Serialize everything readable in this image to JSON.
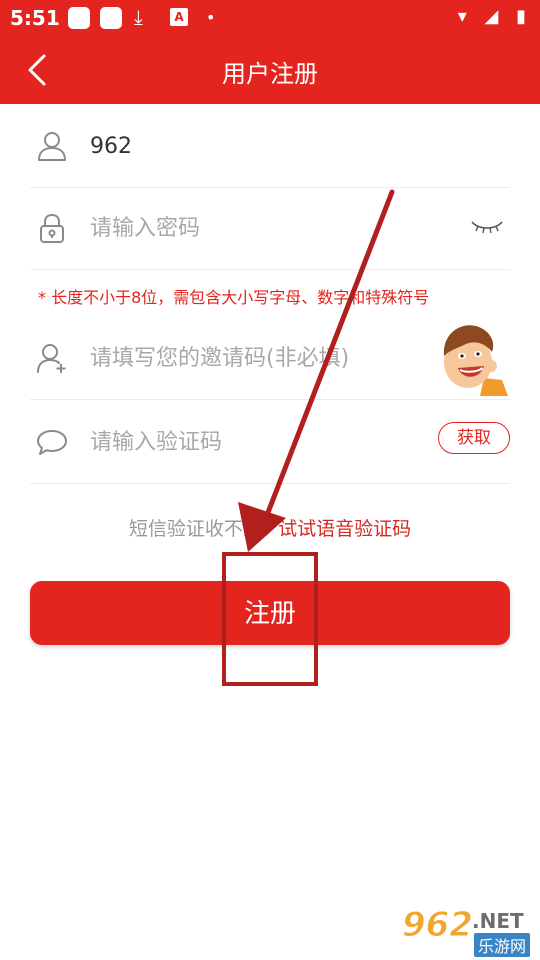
{
  "status_bar": {
    "time": "5:51",
    "download_glyph": "⤓",
    "a_glyph": "A",
    "dot": "•",
    "right_icons": "▾ ◢ ▮"
  },
  "header": {
    "title": "用户注册"
  },
  "form": {
    "username": {
      "value": "962",
      "icon": "user-icon"
    },
    "password": {
      "placeholder": "请输入密码",
      "icon": "lock-icon"
    },
    "password_hint": "* 长度不小于8位，需包含大小写字母、数字和特殊符号",
    "invite": {
      "placeholder": "请填写您的邀请码(非必填)",
      "icon": "add-user-icon"
    },
    "code": {
      "placeholder": "请输入验证码",
      "icon": "chat-bubble-icon",
      "get_label": "获取"
    }
  },
  "voice": {
    "prefix": "短信验证收不到?",
    "link": "试试语音验证码"
  },
  "submit_label": "注册",
  "watermark": {
    "number": "962",
    "suffix": ".NET",
    "site": "乐游网"
  },
  "colors": {
    "brand_red": "#e4251f",
    "annotation_red": "#b1201d",
    "placeholder_gray": "#a8a8a8"
  }
}
